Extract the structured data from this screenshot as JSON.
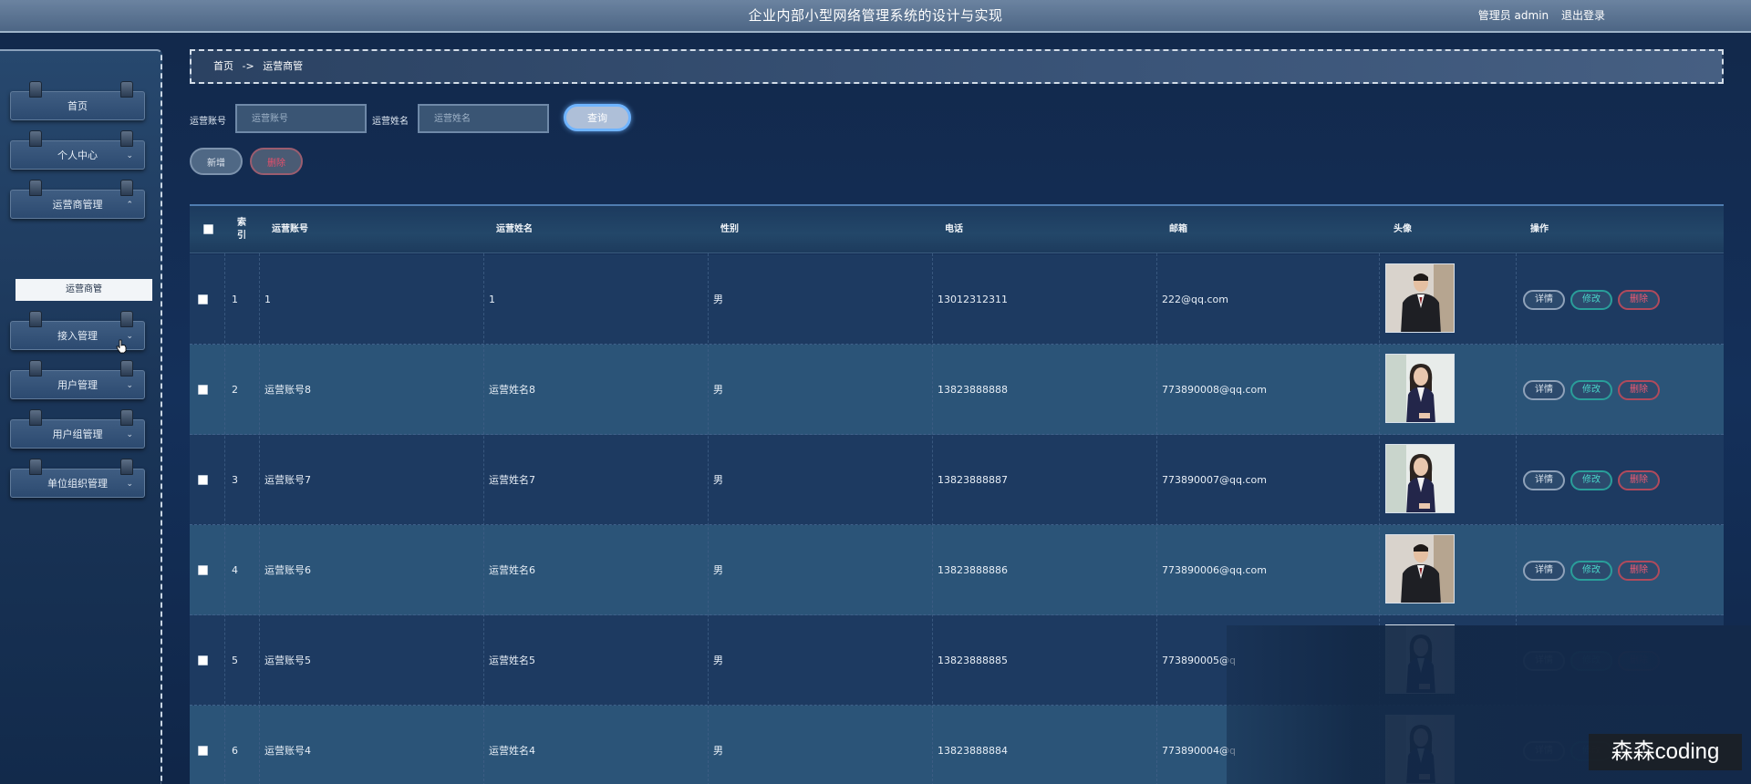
{
  "header": {
    "title": "企业内部小型网络管理系统的设计与实现",
    "user_label": "管理员 admin",
    "logout": "退出登录"
  },
  "sidebar": {
    "items": [
      {
        "label": "首页",
        "chevron": ""
      },
      {
        "label": "个人中心",
        "chevron": "⌄"
      },
      {
        "label": "运营商管理",
        "chevron": "⌃"
      },
      {
        "label": "接入管理",
        "chevron": "⌄"
      },
      {
        "label": "用户管理",
        "chevron": "⌄"
      },
      {
        "label": "用户组管理",
        "chevron": "⌄"
      },
      {
        "label": "单位组织管理",
        "chevron": "⌄"
      }
    ],
    "active_sub": "运营商管"
  },
  "breadcrumb": {
    "home": "首页",
    "sep": "->",
    "current": "运营商管"
  },
  "search": {
    "account_label": "运营账号",
    "account_placeholder": "运营账号",
    "name_label": "运营姓名",
    "name_placeholder": "运营姓名",
    "query_button": "查询"
  },
  "actions": {
    "add": "新增",
    "delete": "删除"
  },
  "table": {
    "headers": {
      "index_top": "索",
      "index_bottom": "引",
      "account": "运营账号",
      "name": "运营姓名",
      "gender": "性别",
      "phone": "电话",
      "email": "邮箱",
      "avatar": "头像",
      "ops": "操作"
    },
    "op_labels": {
      "detail": "详情",
      "edit": "修改",
      "delete": "删除"
    },
    "rows": [
      {
        "idx": "1",
        "account": "1",
        "name": "1",
        "gender": "男",
        "phone": "13012312311",
        "email": "222@qq.com",
        "avatar": "man-suit"
      },
      {
        "idx": "2",
        "account": "运营账号8",
        "name": "运营姓名8",
        "gender": "男",
        "phone": "13823888888",
        "email": "773890008@qq.com",
        "avatar": "woman-suit"
      },
      {
        "idx": "3",
        "account": "运营账号7",
        "name": "运营姓名7",
        "gender": "男",
        "phone": "13823888887",
        "email": "773890007@qq.com",
        "avatar": "woman-suit"
      },
      {
        "idx": "4",
        "account": "运营账号6",
        "name": "运营姓名6",
        "gender": "男",
        "phone": "13823888886",
        "email": "773890006@qq.com",
        "avatar": "man-suit"
      },
      {
        "idx": "5",
        "account": "运营账号5",
        "name": "运营姓名5",
        "gender": "男",
        "phone": "13823888885",
        "email": "773890005@q",
        "avatar": "woman-suit"
      },
      {
        "idx": "6",
        "account": "运营账号4",
        "name": "运营姓名4",
        "gender": "男",
        "phone": "13823888884",
        "email": "773890004@q",
        "avatar": "woman-suit"
      }
    ]
  },
  "watermark": "森森coding",
  "colors": {
    "background": "#14305a",
    "row_odd": "#1d3a61",
    "row_even": "#2b5478",
    "edit_accent": "#2a9e9a",
    "delete_accent": "#f05a72",
    "query_glow": "#6fb4ff"
  }
}
